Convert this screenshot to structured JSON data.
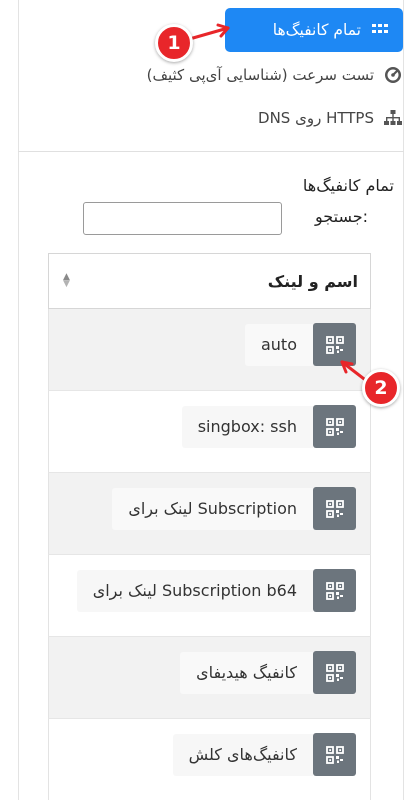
{
  "nav": {
    "items": [
      {
        "label": "تمام کانفیگ‌ها",
        "icon": "grid-icon",
        "active": true
      },
      {
        "label": "تست سرعت (شناسایی آی‌پی کثیف)",
        "icon": "speedometer-icon",
        "active": false
      },
      {
        "label": "DNS روی HTTPS",
        "icon": "sitemap-icon",
        "active": false
      }
    ]
  },
  "section": {
    "title": "تمام کانفیگ‌ها"
  },
  "search": {
    "label": "جستجو:",
    "value": "",
    "placeholder": ""
  },
  "table": {
    "header": "اسم و لینک",
    "rows": [
      {
        "label": "auto"
      },
      {
        "label": "singbox: ssh"
      },
      {
        "label": "لینک برای Subscription"
      },
      {
        "label": "لینک برای Subscription b64"
      },
      {
        "label": "کانفیگ هیدیفای"
      },
      {
        "label": "کانفیگ‌های کلش"
      }
    ]
  },
  "callouts": {
    "one": "1",
    "two": "2"
  },
  "colors": {
    "accent": "#1e88f4",
    "button_gray": "#6c757d",
    "callout_red": "#e8262a"
  }
}
